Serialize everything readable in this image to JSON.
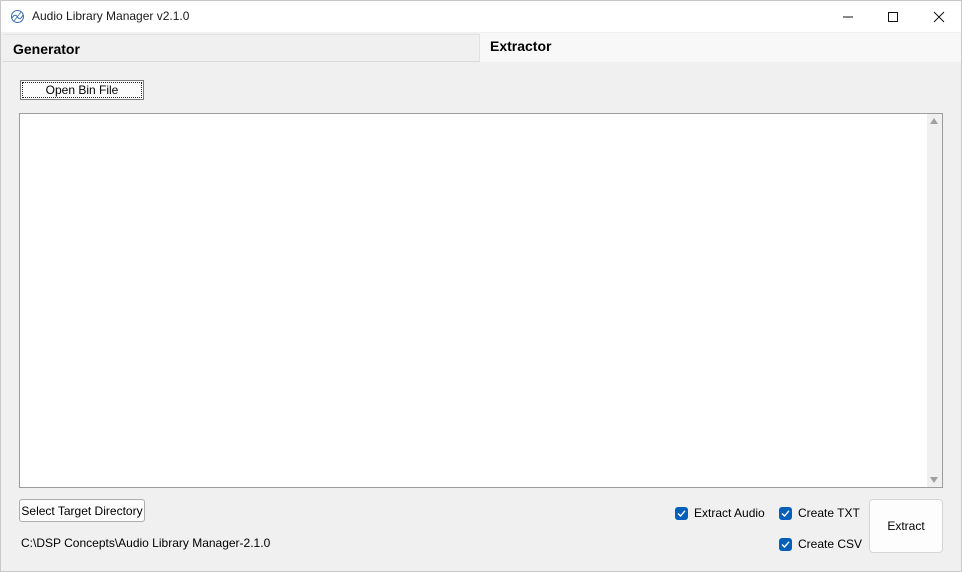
{
  "window": {
    "title": "Audio Library Manager v2.1.0",
    "controls": [
      "minimize-icon",
      "maximize-icon",
      "close-icon"
    ]
  },
  "tabs": [
    {
      "label": "Generator",
      "active": false
    },
    {
      "label": "Extractor",
      "active": true
    }
  ],
  "extractor": {
    "open_button": "Open Bin File",
    "log_text": "",
    "select_dir_button": "Select Target Directory",
    "target_path": "C:\\DSP Concepts\\Audio Library Manager-2.1.0",
    "options": [
      {
        "label": "Extract Audio",
        "checked": true
      },
      {
        "label": "Create TXT",
        "checked": true
      },
      {
        "label": "Create CSV",
        "checked": true
      }
    ],
    "extract_button": "Extract"
  },
  "colors": {
    "accent": "#005fb8",
    "background": "#f0f0f0",
    "titlebar": "#ffffff"
  }
}
